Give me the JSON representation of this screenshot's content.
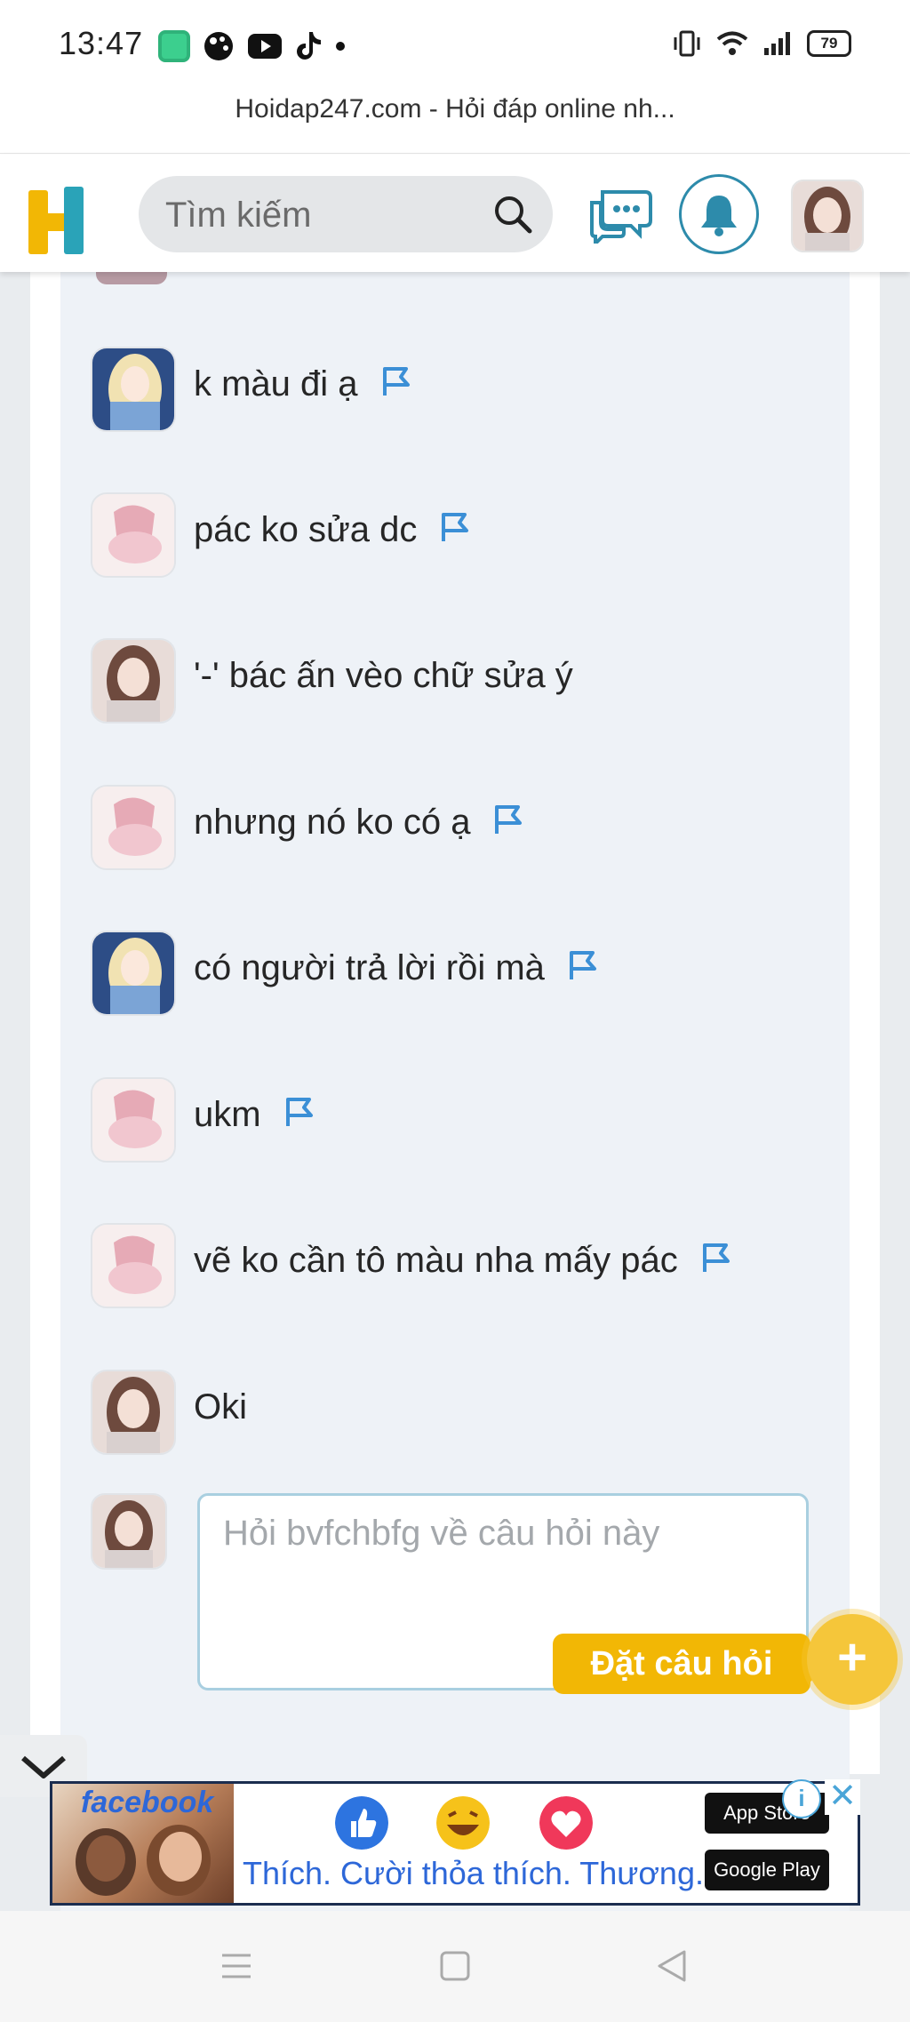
{
  "status_bar": {
    "time": "13:47",
    "battery": "79"
  },
  "browser": {
    "url_title": "Hoidap247.com - Hỏi đáp online nh..."
  },
  "header": {
    "search_placeholder": "Tìm kiếm"
  },
  "comments": [
    {
      "text": "k màu đi ạ",
      "avatar": "anime-girl-blue",
      "flag": true
    },
    {
      "text": "pác ko sửa dc",
      "avatar": "anime-pink-dress",
      "flag": true
    },
    {
      "text": "'-' bác ấn vèo chữ sửa ý",
      "avatar": "anime-brown-hair",
      "flag": false
    },
    {
      "text": "nhưng nó ko có ạ",
      "avatar": "anime-pink-dress",
      "flag": true
    },
    {
      "text": "có người trả lời rồi mà",
      "avatar": "anime-girl-blue",
      "flag": true
    },
    {
      "text": "ukm",
      "avatar": "anime-pink-dress",
      "flag": true
    },
    {
      "text": "vẽ ko cần tô màu nha mấy pác",
      "avatar": "anime-pink-dress",
      "flag": true
    },
    {
      "text": "Oki",
      "avatar": "anime-brown-hair",
      "flag": false
    }
  ],
  "reply": {
    "placeholder": "Hỏi bvfchbfg về câu hỏi này"
  },
  "ask_button": {
    "label": "Đặt câu hỏi",
    "icon": "+"
  },
  "ad": {
    "brand": "facebook",
    "tagline": "Thích. Cười thỏa thích. Thương.",
    "app_store": "App Store",
    "google_play": "Google Play",
    "info_icon": "i",
    "close_icon": "✕"
  },
  "colors": {
    "accent_blue": "#2d8bab",
    "flag_blue": "#3b8fd6",
    "ask_yellow": "#f2b705",
    "logo_yellow": "#f2b705",
    "logo_teal": "#2aa3b8"
  }
}
